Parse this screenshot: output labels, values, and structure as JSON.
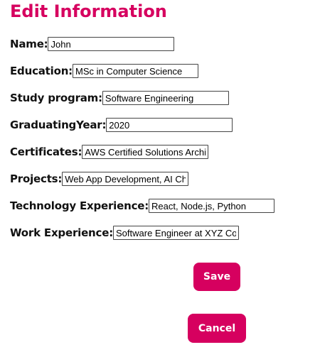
{
  "title": "Edit Information",
  "fields": {
    "name": {
      "label": "Name:",
      "value": "John"
    },
    "education": {
      "label": "Education:",
      "value": "MSc in Computer Science"
    },
    "study_program": {
      "label": "Study program:",
      "value": "Software Engineering"
    },
    "graduating_year": {
      "label": "GraduatingYear:",
      "value": "2020"
    },
    "certificates": {
      "label": "Certificates:",
      "value": "AWS Certified Solutions Architect"
    },
    "projects": {
      "label": "Projects:",
      "value": "Web App Development, AI Chatbot"
    },
    "technology_experience": {
      "label": "Technology Experience:",
      "value": "React, Node.js, Python"
    },
    "work_experience": {
      "label": "Work Experience:",
      "value": "Software Engineer at XYZ Corp"
    }
  },
  "buttons": {
    "save": "Save",
    "cancel": "Cancel"
  },
  "colors": {
    "accent": "#d6005f"
  }
}
